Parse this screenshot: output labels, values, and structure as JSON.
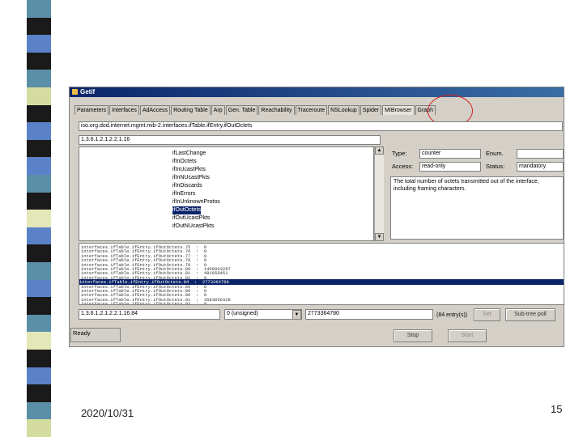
{
  "stripe_colors": [
    "#5b8fa8",
    "#1a1a1a",
    "#5b82c8",
    "#1a1a1a",
    "#5b8fa8",
    "#d4dca0",
    "#1a1a1a",
    "#5b82c8",
    "#1a1a1a",
    "#5b82c8",
    "#5b8fa8",
    "#1a1a1a",
    "#e4e8b8",
    "#5b82c8",
    "#1a1a1a",
    "#5b8fa8",
    "#5b82c8",
    "#1a1a1a",
    "#5b8fa8",
    "#e4e8b8",
    "#1a1a1a",
    "#5b82c8",
    "#1a1a1a",
    "#5b8fa8",
    "#d4dca0"
  ],
  "accent": "#0a246a",
  "window": {
    "title": "Getif",
    "tabs": [
      "Parameters",
      "Interfaces",
      "AdAccess",
      "Routing Table",
      "Arp",
      "Gen. Table",
      "Reachability",
      "Traceroute",
      "NSLookup",
      "Spider",
      "MIBrowser",
      "Graph"
    ],
    "active_tab": "MIBrowser",
    "oid_path": "iso.org.dod.internet.mgmt.mib-2.interfaces.ifTable.ifEntry.ifOutOctets",
    "oid_numeric": "1.3.6.1.2.1.2.2.1.16",
    "tree_items": [
      "ifLastChange",
      "ifInOctets",
      "ifInUcastPkts",
      "ifInNUcastPkts",
      "ifInDiscards",
      "ifInErrors",
      "ifInUnknownProtos",
      "ifOutOctets",
      "ifOutUcastPkts",
      "ifOutNUcastPkts"
    ],
    "selected_tree_item": "ifOutOctets",
    "type_label": "Type:",
    "type_value": "counter",
    "enum_label": "Enum.",
    "access_label": "Access:",
    "access_value": "read-only",
    "status_label": "Status:",
    "status_value": "mandatory",
    "description": "The total number of octets transmitted out of the interface, including framing characters.",
    "results_rows": [
      "interfaces.ifTable.ifEntry.ifOutOctets.75  :  0",
      "interfaces.ifTable.ifEntry.ifOutOctets.76  :  0",
      "interfaces.ifTable.ifEntry.ifOutOctets.77  :  0",
      "interfaces.ifTable.ifEntry.ifOutOctets.78  :  0",
      "interfaces.ifTable.ifEntry.ifOutOctets.79  :  0",
      "interfaces.ifTable.ifEntry.ifOutOctets.80  :  1458963287",
      "interfaces.ifTable.ifEntry.ifOutOctets.81  :  481658451",
      "interfaces.ifTable.ifEntry.ifOutOctets.82  :  0",
      "interfaces.ifTable.ifEntry.ifOutOctets.84  :  2773364780",
      "interfaces.ifTable.ifEntry.ifOutOctets.85  :  0",
      "interfaces.ifTable.ifEntry.ifOutOctets.86  :  0",
      "interfaces.ifTable.ifEntry.ifOutOctets.90  :  0",
      "interfaces.ifTable.ifEntry.ifOutOctets.91  :  3583856328",
      "interfaces.ifTable.ifEntry.ifOutOctets.92  :  0"
    ],
    "selected_row_index": 8,
    "bottom_oid": "1.3.6.1.2.1.2.2.1.16.84",
    "type_select": "0 (unsigned)",
    "value_field": "2773364780",
    "entries_label": "(84 entry(s))",
    "set_button": "Set",
    "sub_tree_button": "Sub-tree poll",
    "status_text": "Ready",
    "stop_button": "Stop",
    "start_button": "Start"
  },
  "footer": {
    "date": "2020/10/31",
    "page": "15"
  }
}
